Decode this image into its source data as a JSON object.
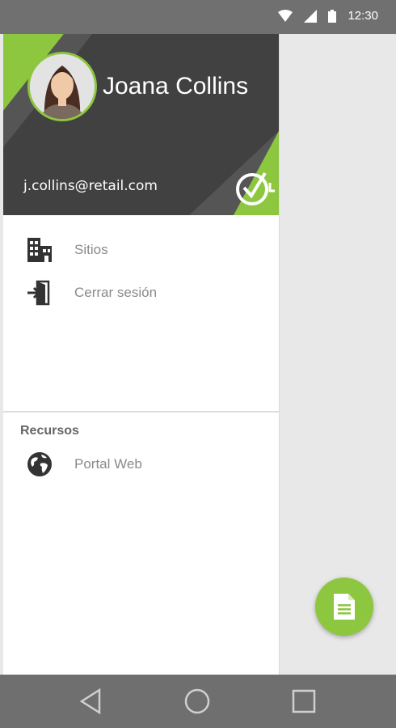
{
  "status_bar": {
    "time": "12:30",
    "icons": [
      "wifi-icon",
      "signal-icon",
      "battery-icon"
    ]
  },
  "drawer": {
    "header": {
      "user_name": "Joana Collins",
      "user_email": "j.collins@retail.com",
      "avatar": "profile-photo",
      "logo": "check-clock-logo"
    },
    "menu": [
      {
        "label": "Sitios",
        "icon": "building-icon"
      },
      {
        "label": "Cerrar sesión",
        "icon": "logout-door-icon"
      }
    ],
    "resources_section": {
      "title": "Recursos",
      "items": [
        {
          "label": "Portal Web",
          "icon": "globe-icon"
        }
      ]
    }
  },
  "fab": {
    "icon": "document-icon"
  },
  "nav_bar": {
    "buttons": [
      "back-icon",
      "home-icon",
      "recents-icon"
    ]
  },
  "colors": {
    "accent": "#8dc63f",
    "header_dark": "#414141",
    "header_mid": "#555555",
    "status_bar": "#707070",
    "nav_bar": "#6f6f6f",
    "background": "#e8e8e8"
  }
}
